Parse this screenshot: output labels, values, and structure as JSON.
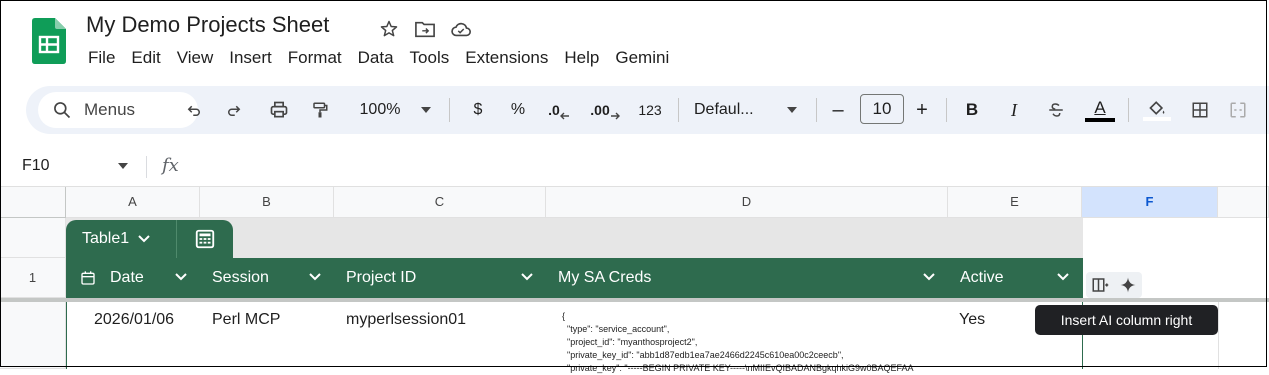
{
  "doc": {
    "title": "My Demo Projects Sheet"
  },
  "menu": [
    "File",
    "Edit",
    "View",
    "Insert",
    "Format",
    "Data",
    "Tools",
    "Extensions",
    "Help",
    "Gemini"
  ],
  "toolbar": {
    "search_label": "Menus",
    "zoom": "100%",
    "currency": "$",
    "percent": "%",
    "decrease_decimal": ".0",
    "increase_decimal": ".00",
    "number_format": "123",
    "font": "Defaul...",
    "font_size": "10",
    "minus": "–",
    "plus": "+",
    "bold": "B",
    "italic": "I",
    "text_color_letter": "A"
  },
  "formula_bar": {
    "cell_ref": "F10",
    "fx": "fx"
  },
  "columns": [
    "A",
    "B",
    "C",
    "D",
    "E",
    "F"
  ],
  "rows": [
    "1"
  ],
  "table": {
    "name": "Table1",
    "headers": [
      "Date",
      "Session",
      "Project ID",
      "My SA Creds",
      "Active"
    ],
    "row": {
      "date": "2026/01/06",
      "session": "Perl MCP",
      "project_id": "myperlsession01",
      "creds": "{\n  \"type\": \"service_account\",\n  \"project_id\": \"myanthosproject2\",\n  \"private_key_id\": \"abb1d87edb1ea7ae2466d2245c610ea00c2ceecb\",\n  \"private_key\": \"-----BEGIN PRIVATE KEY-----\\nMIIEvQIBADANBgkqhkiG9w0BAQEFAA",
      "active": "Yes"
    }
  },
  "tooltip": "Insert AI column right",
  "colors": {
    "brand_green": "#2e6b4e",
    "logo_green": "#0f9d58",
    "selected_col": "#d3e3fd"
  }
}
